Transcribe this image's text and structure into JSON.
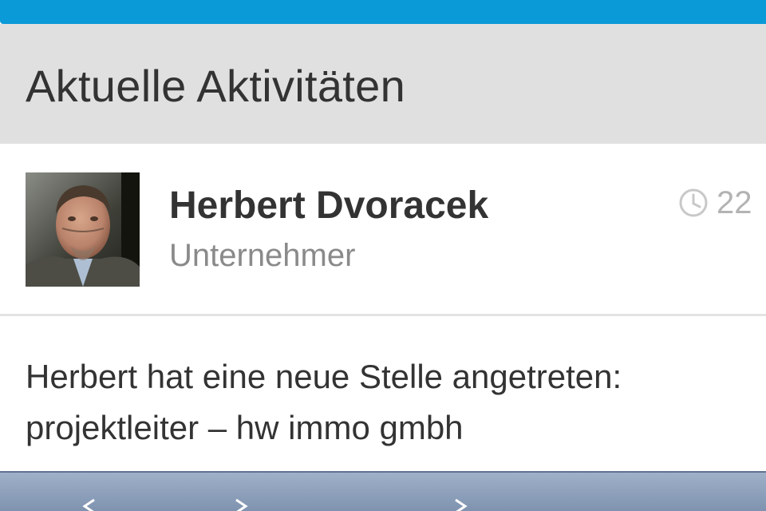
{
  "colors": {
    "accent": "#0b9ad8",
    "header_bg": "#e0e0e0",
    "text_primary": "#333333",
    "text_secondary": "#8a8a8a",
    "toolbar": "#8fa2bd"
  },
  "header": {
    "title": "Aktuelle Aktivitäten"
  },
  "activity": {
    "author_name": "Herbert Dvoracek",
    "author_title": "Unternehmer",
    "timestamp_icon": "clock-icon",
    "timestamp": "22",
    "text_line1": "Herbert hat eine neue Stelle angetreten:",
    "text_line2": "projektleiter – hw immo gmbh"
  },
  "toolbar": {
    "icons": [
      "back-arrow-icon",
      "share-icon",
      "forward-arrow-icon"
    ]
  }
}
